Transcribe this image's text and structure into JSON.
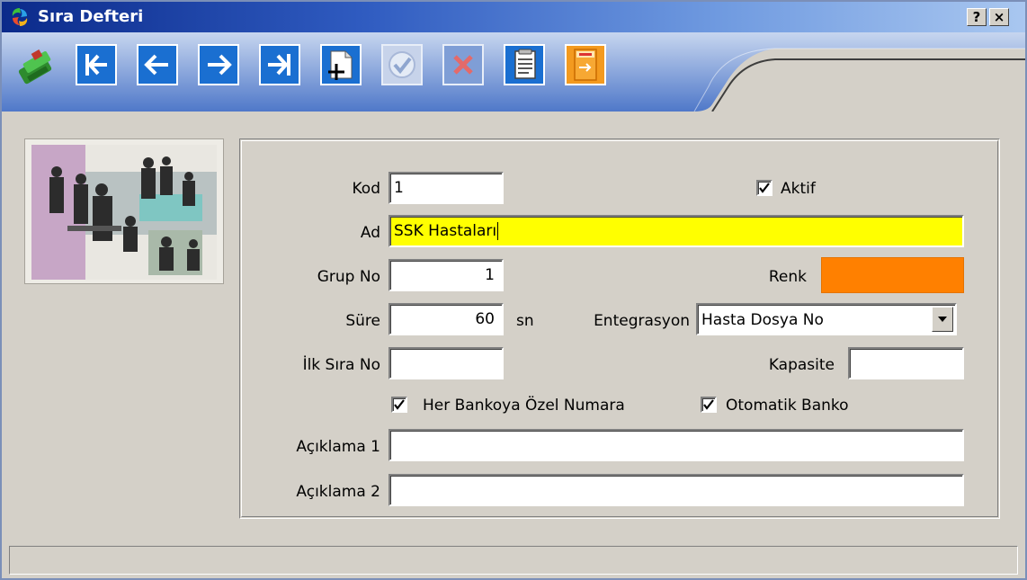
{
  "window": {
    "title": "Sıra Defteri",
    "help_label": "?",
    "close_label": "×"
  },
  "toolbar": {
    "buttons": [
      {
        "name": "cash-register-icon"
      },
      {
        "name": "first-record-icon"
      },
      {
        "name": "previous-record-icon"
      },
      {
        "name": "next-record-icon"
      },
      {
        "name": "last-record-icon"
      },
      {
        "name": "new-record-icon"
      },
      {
        "name": "save-check-icon"
      },
      {
        "name": "delete-x-icon"
      },
      {
        "name": "list-document-icon"
      },
      {
        "name": "exit-door-icon"
      }
    ]
  },
  "form": {
    "kod_label": "Kod",
    "kod_value": "1",
    "aktif_label": "Aktif",
    "aktif_checked": true,
    "ad_label": "Ad",
    "ad_value": "SSK Hastaları",
    "grup_label": "Grup No",
    "grup_value": "1",
    "renk_label": "Renk",
    "renk_color": "#ff8000",
    "sure_label": "Süre",
    "sure_value": "60",
    "sure_unit": "sn",
    "entegrasyon_label": "Entegrasyon",
    "entegrasyon_value": "Hasta Dosya No",
    "ilk_sira_label": "İlk Sıra No",
    "ilk_sira_value": "",
    "kapasite_label": "Kapasite",
    "kapasite_value": "",
    "her_bankoya_label": "Her Bankoya Özel Numara",
    "her_bankoya_checked": true,
    "otomatik_banko_label": "Otomatik Banko",
    "otomatik_banko_checked": true,
    "aciklama1_label": "Açıklama 1",
    "aciklama1_value": "",
    "aciklama2_label": "Açıklama 2",
    "aciklama2_value": ""
  },
  "status": {
    "text": ""
  }
}
